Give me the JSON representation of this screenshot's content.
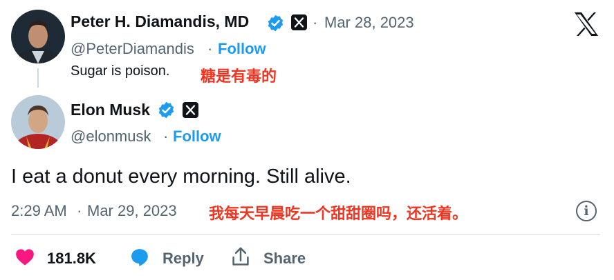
{
  "quoted_tweet": {
    "author_name": "Peter H. Diamandis, MD",
    "handle": "@PeterDiamandis",
    "separator": "·",
    "date": "Mar 28, 2023",
    "follow_label": "Follow",
    "text": "Sugar is poison.",
    "translation": "糖是有毒的"
  },
  "reply_tweet": {
    "author_name": "Elon Musk",
    "handle": "@elonmusk",
    "separator": "·",
    "follow_label": "Follow",
    "text": "I eat a donut every morning. Still alive.",
    "time": "2:29 AM",
    "date": "Mar 29, 2023",
    "translation": "我每天早晨吃一个甜甜圈吗，还活着。"
  },
  "actions": {
    "likes": "181.8K",
    "reply_label": "Reply",
    "share_label": "Share"
  },
  "colors": {
    "verified_blue": "#1d9bf0",
    "like_pink": "#f91880",
    "reply_blue": "#1d9bf0",
    "translation_red": "#f0341f",
    "muted_gray": "#536471"
  },
  "icons": [
    "verified-badge-icon",
    "x-logo-icon",
    "info-icon",
    "heart-icon",
    "reply-bubble-icon",
    "share-icon"
  ]
}
